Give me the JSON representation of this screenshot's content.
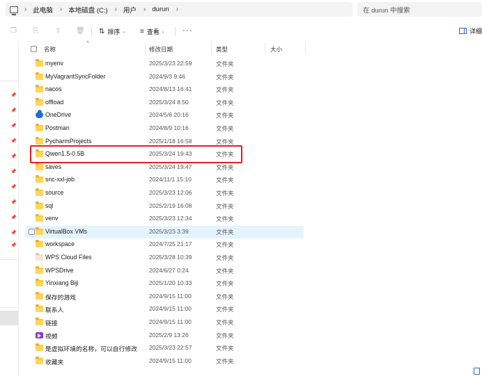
{
  "address_bar": {
    "breadcrumbs": [
      "此电脑",
      "本地磁盘 (C:)",
      "用户",
      "durun"
    ],
    "separator": ">"
  },
  "search": {
    "placeholder": "在 durun 中搜索"
  },
  "toolbar": {
    "sort_label": "排序",
    "view_label": "查看",
    "more_label": "···",
    "details_label": "详细"
  },
  "columns": {
    "name": "名称",
    "date": "修改日期",
    "type": "类型",
    "size": "大小"
  },
  "files": [
    {
      "name": "myenv",
      "date": "2025/3/23 22:59",
      "type": "文件夹",
      "icon": "folder-icon"
    },
    {
      "name": "MyVagrantSyncFolder",
      "date": "2024/9/3 9:46",
      "type": "文件夹",
      "icon": "folder-icon"
    },
    {
      "name": "nacos",
      "date": "2024/8/13 16:41",
      "type": "文件夹",
      "icon": "folder-icon"
    },
    {
      "name": "offload",
      "date": "2025/3/24 8:50",
      "type": "文件夹",
      "icon": "folder-icon"
    },
    {
      "name": "OneDrive",
      "date": "2024/5/6 20:16",
      "type": "文件夹",
      "icon": "cloud-icon"
    },
    {
      "name": "Postman",
      "date": "2024/8/9 10:16",
      "type": "文件夹",
      "icon": "folder-icon"
    },
    {
      "name": "PycharmProjects",
      "date": "2025/1/18 16:58",
      "type": "文件夹",
      "icon": "folder-icon"
    },
    {
      "name": "Qwen1.5-0.5B",
      "date": "2025/3/24 19:43",
      "type": "文件夹",
      "icon": "folder-icon"
    },
    {
      "name": "saves",
      "date": "2025/3/24 19:47",
      "type": "文件夹",
      "icon": "folder-icon"
    },
    {
      "name": "snc-xxl-job",
      "date": "2024/11/1 15:10",
      "type": "文件夹",
      "icon": "folder-icon"
    },
    {
      "name": "source",
      "date": "2025/3/23 12:06",
      "type": "文件夹",
      "icon": "folder-icon"
    },
    {
      "name": "sql",
      "date": "2025/2/19 16:08",
      "type": "文件夹",
      "icon": "folder-icon"
    },
    {
      "name": "venv",
      "date": "2025/3/23 12:34",
      "type": "文件夹",
      "icon": "folder-icon"
    },
    {
      "name": "VirtualBox VMs",
      "date": "2025/3/23 3:39",
      "type": "文件夹",
      "icon": "folder-icon"
    },
    {
      "name": "workspace",
      "date": "2024/7/25 21:17",
      "type": "文件夹",
      "icon": "folder-icon"
    },
    {
      "name": "WPS Cloud Files",
      "date": "2025/3/28 10:39",
      "type": "文件夹",
      "icon": "folder-light-icon"
    },
    {
      "name": "WPSDrive",
      "date": "2024/6/27 0:24",
      "type": "文件夹",
      "icon": "folder-icon"
    },
    {
      "name": "Yinxiang Biji",
      "date": "2025/1/20 10:33",
      "type": "文件夹",
      "icon": "folder-icon"
    },
    {
      "name": "保存的游戏",
      "date": "2024/9/15 11:00",
      "type": "文件夹",
      "icon": "folder-icon"
    },
    {
      "name": "联系人",
      "date": "2024/9/15 11:00",
      "type": "文件夹",
      "icon": "folder-icon"
    },
    {
      "name": "链接",
      "date": "2024/9/15 11:00",
      "type": "文件夹",
      "icon": "folder-icon"
    },
    {
      "name": "视频",
      "date": "2025/2/9 13:26",
      "type": "文件夹",
      "icon": "video-icon"
    },
    {
      "name": "是虚拟环境的名称，可以自行修改",
      "date": "2025/3/23 22:57",
      "type": "文件夹",
      "icon": "folder-icon"
    },
    {
      "name": "收藏夹",
      "date": "2024/9/15 11:00",
      "type": "文件夹",
      "icon": "folder-icon"
    }
  ],
  "hover_row_index": 13,
  "highlighted_row_index": 7,
  "colors": {
    "highlight_border": "#e02020",
    "hover_bg": "#e5f3ff",
    "folder": "#ffd65c"
  }
}
